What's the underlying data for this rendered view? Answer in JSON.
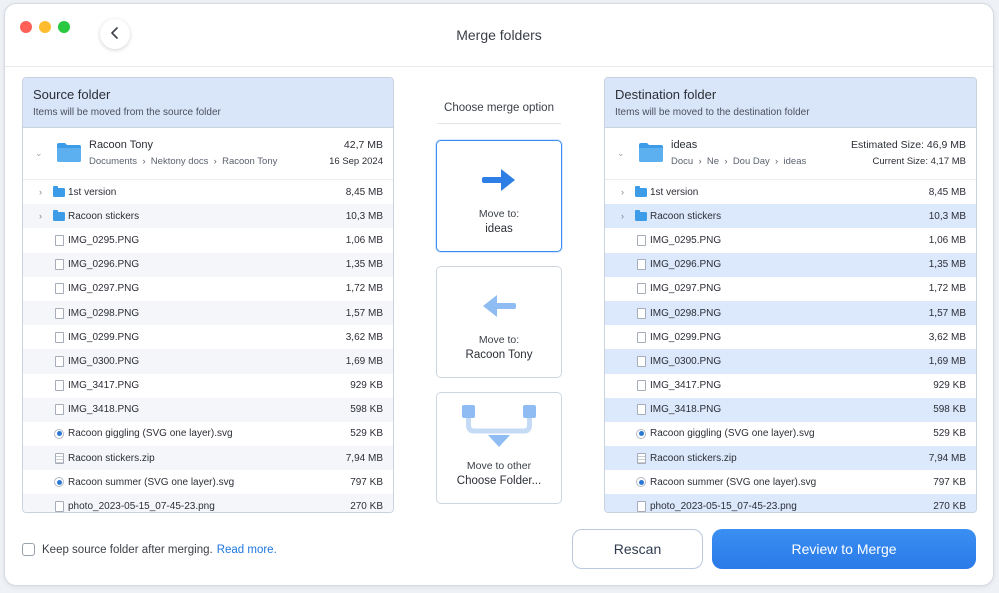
{
  "window": {
    "title": "Merge folders"
  },
  "source": {
    "title": "Source folder",
    "subtitle": "Items will be moved from the source folder",
    "folder": {
      "name": "Racoon Tony",
      "path": [
        "Documents",
        "Nektony docs",
        "Racoon Tony"
      ],
      "size": "42,7 MB",
      "date": "16 Sep 2024"
    },
    "items": [
      {
        "name": "1st version",
        "size": "8,45 MB",
        "type": "folder"
      },
      {
        "name": "Racoon stickers",
        "size": "10,3 MB",
        "type": "folder"
      },
      {
        "name": "IMG_0295.PNG",
        "size": "1,06 MB",
        "type": "file"
      },
      {
        "name": "IMG_0296.PNG",
        "size": "1,35 MB",
        "type": "file"
      },
      {
        "name": "IMG_0297.PNG",
        "size": "1,72 MB",
        "type": "file"
      },
      {
        "name": "IMG_0298.PNG",
        "size": "1,57 MB",
        "type": "file"
      },
      {
        "name": "IMG_0299.PNG",
        "size": "3,62 MB",
        "type": "file"
      },
      {
        "name": "IMG_0300.PNG",
        "size": "1,69 MB",
        "type": "file"
      },
      {
        "name": "IMG_3417.PNG",
        "size": "929 KB",
        "type": "file"
      },
      {
        "name": "IMG_3418.PNG",
        "size": "598 KB",
        "type": "file"
      },
      {
        "name": "Racoon giggling (SVG one layer).svg",
        "size": "529 KB",
        "type": "svg"
      },
      {
        "name": "Racoon stickers.zip",
        "size": "7,94 MB",
        "type": "zip"
      },
      {
        "name": "Racoon summer (SVG one layer).svg",
        "size": "797 KB",
        "type": "svg"
      },
      {
        "name": "photo_2023-05-15_07-45-23.png",
        "size": "270 KB",
        "type": "file"
      }
    ]
  },
  "destination": {
    "title": "Destination folder",
    "subtitle": "Items will be moved to the destination folder",
    "folder": {
      "name": "ideas",
      "path": [
        "Docu",
        "Ne",
        "Dou Day",
        "ideas"
      ],
      "estimated_size": "Estimated Size: 46,9 MB",
      "current_size": "Current Size: 4,17 MB"
    },
    "items": [
      {
        "name": "1st version",
        "size": "8,45 MB",
        "type": "folder"
      },
      {
        "name": "Racoon stickers",
        "size": "10,3 MB",
        "type": "folder"
      },
      {
        "name": "IMG_0295.PNG",
        "size": "1,06 MB",
        "type": "file"
      },
      {
        "name": "IMG_0296.PNG",
        "size": "1,35 MB",
        "type": "file"
      },
      {
        "name": "IMG_0297.PNG",
        "size": "1,72 MB",
        "type": "file"
      },
      {
        "name": "IMG_0298.PNG",
        "size": "1,57 MB",
        "type": "file"
      },
      {
        "name": "IMG_0299.PNG",
        "size": "3,62 MB",
        "type": "file"
      },
      {
        "name": "IMG_0300.PNG",
        "size": "1,69 MB",
        "type": "file"
      },
      {
        "name": "IMG_3417.PNG",
        "size": "929 KB",
        "type": "file"
      },
      {
        "name": "IMG_3418.PNG",
        "size": "598 KB",
        "type": "file"
      },
      {
        "name": "Racoon giggling (SVG one layer).svg",
        "size": "529 KB",
        "type": "svg"
      },
      {
        "name": "Racoon stickers.zip",
        "size": "7,94 MB",
        "type": "zip"
      },
      {
        "name": "Racoon summer (SVG one layer).svg",
        "size": "797 KB",
        "type": "svg"
      },
      {
        "name": "photo_2023-05-15_07-45-23.png",
        "size": "270 KB",
        "type": "file"
      }
    ]
  },
  "merge": {
    "label": "Choose merge option",
    "options": [
      {
        "line1": "Move to:",
        "line2": "ideas",
        "icon": "arrow-right-icon",
        "selected": true
      },
      {
        "line1": "Move to:",
        "line2": "Racoon Tony",
        "icon": "arrow-left-icon",
        "selected": false
      },
      {
        "line1": "Move to other",
        "line2": "Choose Folder...",
        "icon": "merge-down-icon",
        "selected": false
      }
    ]
  },
  "footer": {
    "keep_label": "Keep source folder after merging.",
    "read_more": "Read more.",
    "rescan": "Rescan",
    "review": "Review to Merge"
  },
  "colors": {
    "accent": "#2a7ae8",
    "panel_header": "#d9e5f8",
    "folder": "#3d9ce8",
    "highlight_row": "#dce8fb"
  }
}
